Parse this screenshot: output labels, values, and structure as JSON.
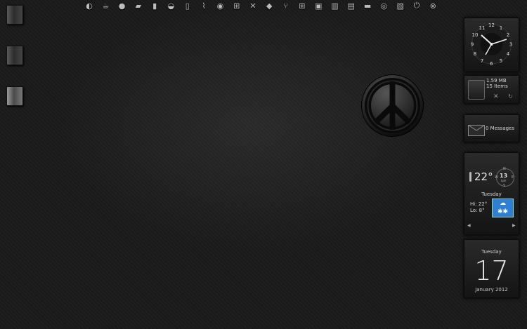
{
  "dock": {
    "icons": [
      "power-orb-icon",
      "coffee-icon",
      "chat-icon",
      "book-icon",
      "bookmark-icon",
      "hat-icon",
      "door-icon",
      "broom-icon",
      "globe-icon",
      "windows-icon",
      "tools-icon",
      "paint-icon",
      "network-icon",
      "windows-logo-icon",
      "monitor-icon",
      "trash-icon",
      "document-icon",
      "display-icon",
      "disc-icon",
      "image-icon",
      "shutdown-icon",
      "close-icon"
    ]
  },
  "clock": {
    "numbers": [
      "12",
      "1",
      "2",
      "3",
      "4",
      "5",
      "6",
      "7",
      "8",
      "9",
      "10",
      "11"
    ]
  },
  "recycle": {
    "size": "1.59 MB",
    "items": "15 Items"
  },
  "mail": {
    "label": "0 Messages"
  },
  "weather": {
    "temp": "22°",
    "compass_n": "N",
    "compass_e": "E",
    "compass_s": "S",
    "compass_w": "W",
    "wind": "13",
    "wind_unit": "kph",
    "day": "Tuesday",
    "hi": "Hi:  22°",
    "lo": "Lo:  8°"
  },
  "calendar": {
    "weekday": "Tuesday",
    "date": "17",
    "month": "January 2012"
  },
  "colors": {
    "background": "#1a1a1a",
    "weather_icon_blue": "#2f7fd4"
  }
}
